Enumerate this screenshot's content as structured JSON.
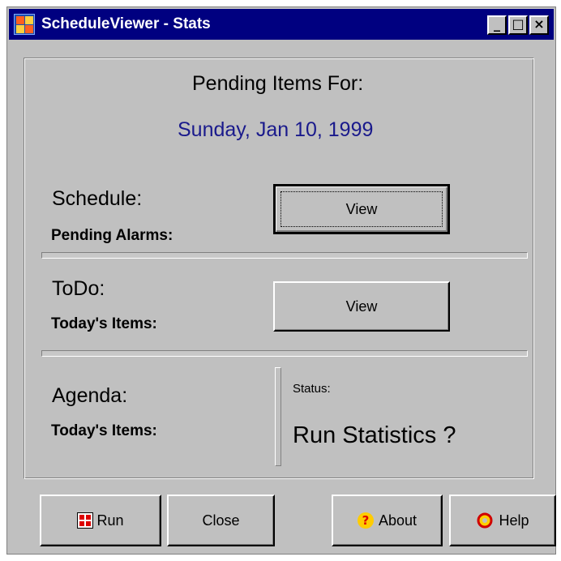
{
  "window": {
    "title": "ScheduleViewer - Stats",
    "controls": {
      "minimize": "_",
      "maximize": "□",
      "close": "×"
    }
  },
  "header": {
    "heading": "Pending Items For:",
    "date": "Sunday, Jan 10, 1999",
    "date_color": "#1a1a8c"
  },
  "schedule": {
    "title": "Schedule:",
    "subtitle": "Pending Alarms:",
    "view_label": "View"
  },
  "todo": {
    "title": "ToDo:",
    "subtitle": "Today's Items:",
    "view_label": "View"
  },
  "agenda": {
    "title": "Agenda:",
    "subtitle": "Today's Items:"
  },
  "status": {
    "label": "Status:",
    "text": "Run Statistics ?"
  },
  "buttons": {
    "run": "Run",
    "close": "Close",
    "about": "About",
    "help": "Help"
  },
  "icons": {
    "app": "calendar-grid-icon",
    "run": "run-calendar-icon",
    "about": "question-icon",
    "help": "help-lifebuoy-icon"
  }
}
